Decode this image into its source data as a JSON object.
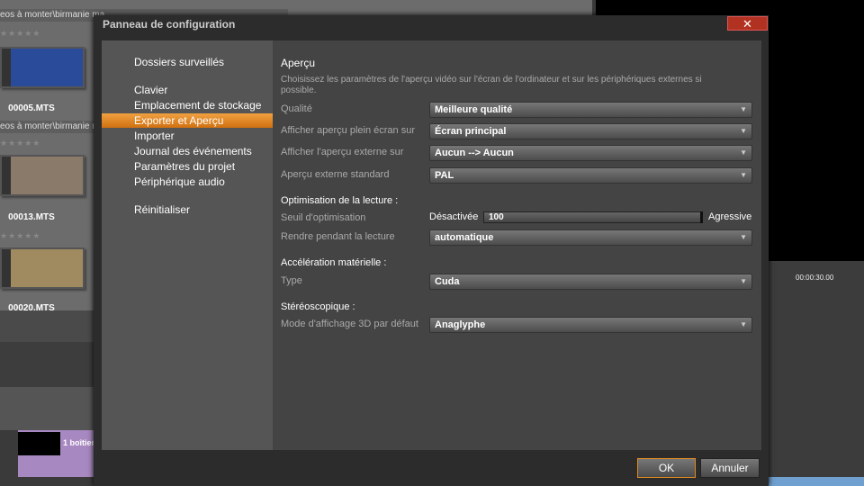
{
  "background": {
    "library": {
      "path_1": "eos à monter\\birmanie ma",
      "path_2": "eos à monter\\birmanie ma",
      "stars": "★★★★★",
      "clips": [
        "00005.MTS",
        "00013.MTS",
        "00020.MTS"
      ]
    },
    "timecode": "00:00:30.00",
    "track_label": "1 boîtier"
  },
  "dialog": {
    "title": "Panneau de configuration",
    "close_label": "✕",
    "sidebar": [
      {
        "label": "Dossiers surveillés"
      },
      {
        "label": "Clavier"
      },
      {
        "label": "Emplacement de stockage"
      },
      {
        "label": "Exporter et Aperçu",
        "active": true
      },
      {
        "label": "Importer"
      },
      {
        "label": "Journal des événements"
      },
      {
        "label": "Paramètres du projet"
      },
      {
        "label": "Périphérique audio"
      },
      {
        "label": "Réinitialiser"
      }
    ],
    "content": {
      "heading": "Aperçu",
      "description": "Choisissez les paramètres de l'aperçu vidéo sur l'écran de l'ordinateur et sur les périphériques externes si possible.",
      "fields": [
        {
          "label": "Qualité",
          "value": "Meilleure qualité"
        },
        {
          "label": "Afficher aperçu plein écran sur",
          "value": "Écran principal"
        },
        {
          "label": "Afficher l'aperçu externe sur",
          "value": "Aucun --> Aucun"
        },
        {
          "label": "Aperçu externe standard",
          "value": "PAL"
        }
      ],
      "playback": {
        "heading": "Optimisation de la lecture :",
        "threshold_label": "Seuil d'optimisation",
        "slider_min": "Désactivée",
        "slider_max": "Agressive",
        "slider_value": "100",
        "render_label": "Rendre pendant la lecture",
        "render_value": "automatique"
      },
      "hardware": {
        "heading": "Accélération matérielle :",
        "type_label": "Type",
        "type_value": "Cuda"
      },
      "stereo": {
        "heading": "Stéréoscopique :",
        "mode_label": "Mode d'affichage 3D par défaut",
        "mode_value": "Anaglyphe"
      }
    },
    "ok_label": "OK",
    "cancel_label": "Annuler"
  },
  "colors": {
    "accent": "#e08a20",
    "close": "#b23222"
  }
}
